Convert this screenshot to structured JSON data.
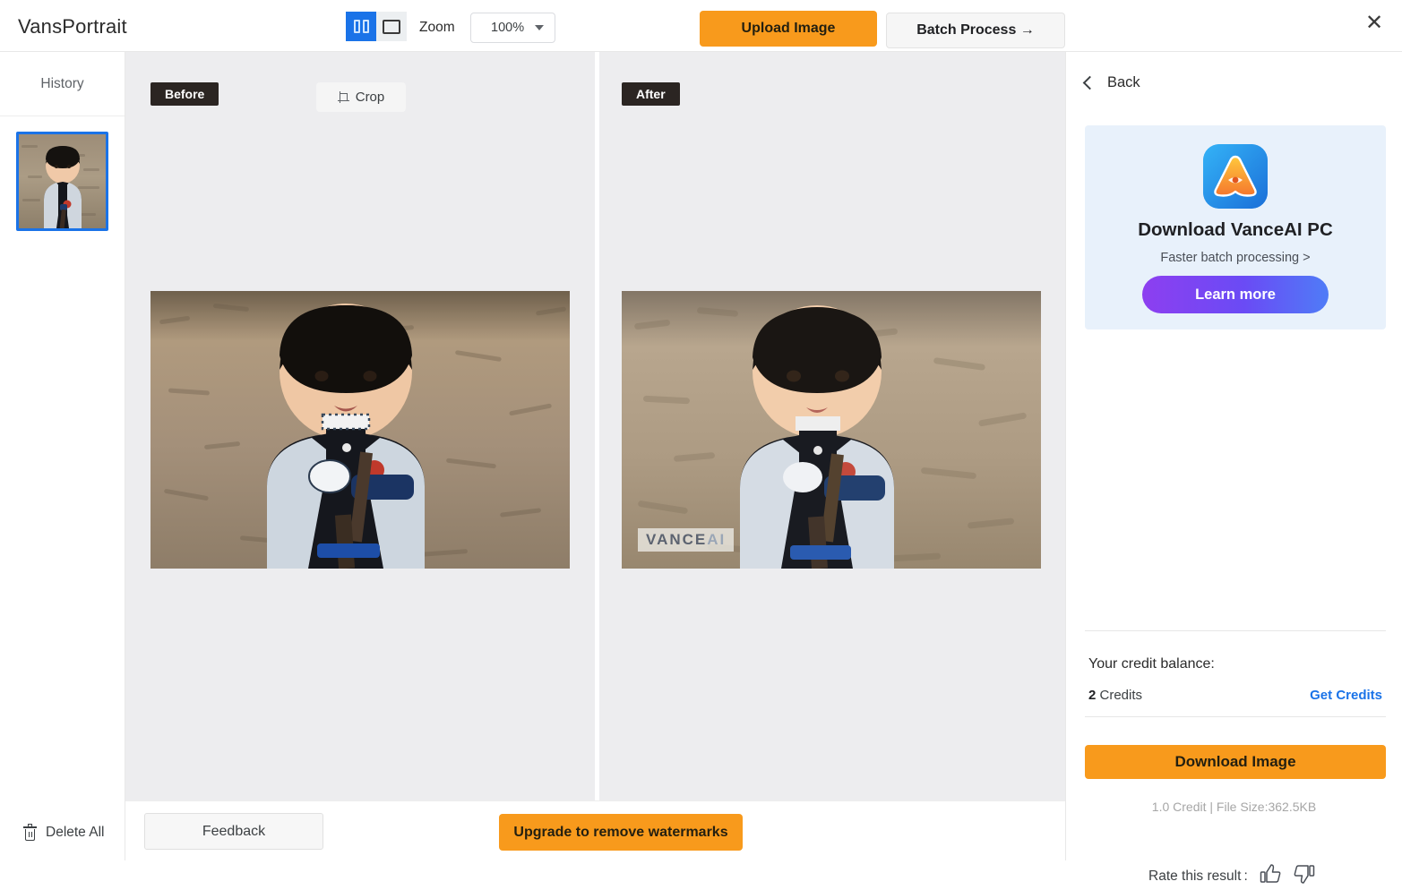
{
  "app": {
    "brand": "VansPortrait"
  },
  "toolbar": {
    "view_split_icon": "split-view-icon",
    "view_single_icon": "single-view-icon",
    "zoom_label": "Zoom",
    "zoom_value": "100%",
    "upload_label": "Upload Image",
    "batch_label": "Batch Process →",
    "close_icon": "✕"
  },
  "sidebar": {
    "history_label": "History",
    "delete_all_label": "Delete All",
    "thumbnail_name": "history-thumbnail-1"
  },
  "canvas": {
    "before_tag": "Before",
    "after_tag": "After",
    "crop_label": "Crop",
    "watermark_text": "VANCE",
    "watermark_suffix": "AI"
  },
  "bottom": {
    "feedback_label": "Feedback",
    "upgrade_label": "Upgrade to remove watermarks"
  },
  "right": {
    "back_label": "Back",
    "promo": {
      "title": "Download VanceAI PC",
      "subtitle": "Faster batch processing >",
      "button_label": "Learn more"
    },
    "credit_label": "Your credit balance:",
    "credit_amount": "2",
    "credit_unit": " Credits",
    "get_credits_label": "Get Credits",
    "download_label": "Download Image",
    "file_meta": "1.0 Credit | File Size:362.5KB",
    "rate_label": "Rate this result :",
    "thumbs_up_icon": "thumbs-up-icon",
    "thumbs_down_icon": "thumbs-down-icon"
  },
  "colors": {
    "accent_orange": "#f89a1c",
    "accent_blue": "#1a73e8",
    "promo_bg": "#e8f1fb",
    "canvas_bg": "#ededef"
  }
}
